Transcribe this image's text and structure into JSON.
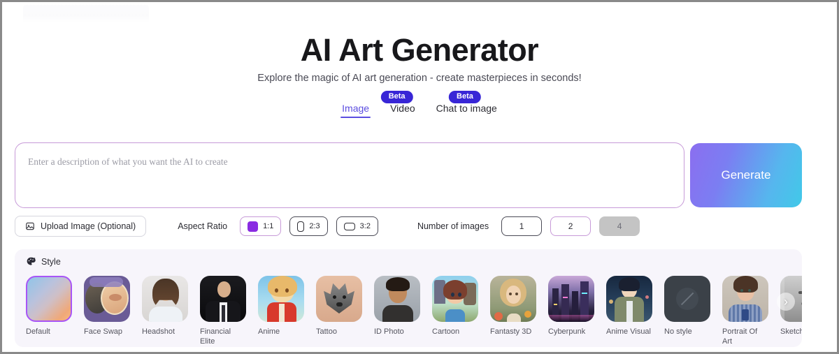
{
  "header": {
    "title": "AI Art Generator",
    "subtitle": "Explore the magic of AI art generation - create masterpieces in seconds!"
  },
  "tabs": [
    {
      "label": "Image",
      "active": true,
      "beta": null
    },
    {
      "label": "Video",
      "active": false,
      "beta": "Beta"
    },
    {
      "label": "Chat to image",
      "active": false,
      "beta": "Beta"
    }
  ],
  "prompt": {
    "placeholder": "Enter a description of what you want the AI to create",
    "value": "",
    "generate_label": "Generate",
    "border_color": "#c79ad8"
  },
  "options": {
    "upload_label": "Upload Image (Optional)",
    "upload_icon": "image-icon",
    "aspect_ratio_label": "Aspect Ratio",
    "aspect_ratios": [
      {
        "label": "1:1",
        "selected": true
      },
      {
        "label": "2:3",
        "selected": false
      },
      {
        "label": "3:2",
        "selected": false
      }
    ],
    "number_label": "Number of images",
    "numbers": [
      {
        "label": "1",
        "selected": false,
        "disabled": false
      },
      {
        "label": "2",
        "selected": true,
        "disabled": false
      },
      {
        "label": "4",
        "selected": false,
        "disabled": true
      }
    ]
  },
  "style": {
    "section_label": "Style",
    "section_icon": "palette-icon",
    "next_icon": "chevron-right-icon",
    "items": [
      {
        "name": "Default",
        "selected": true
      },
      {
        "name": "Face Swap",
        "selected": false
      },
      {
        "name": "Headshot",
        "selected": false
      },
      {
        "name": "Financial Elite",
        "selected": false
      },
      {
        "name": "Anime",
        "selected": false
      },
      {
        "name": "Tattoo",
        "selected": false
      },
      {
        "name": "ID Photo",
        "selected": false
      },
      {
        "name": "Cartoon",
        "selected": false
      },
      {
        "name": "Fantasty 3D",
        "selected": false
      },
      {
        "name": "Cyberpunk",
        "selected": false
      },
      {
        "name": "Anime Visual",
        "selected": false
      },
      {
        "name": "No style",
        "selected": false
      },
      {
        "name": "Portrait Of Art",
        "selected": false
      },
      {
        "name": "Sketch",
        "selected": false
      }
    ]
  },
  "colors": {
    "accent": "#5b4de0",
    "badge": "#3826d6",
    "selected_border": "#a855f7",
    "panel_bg": "#f7f5fb"
  }
}
